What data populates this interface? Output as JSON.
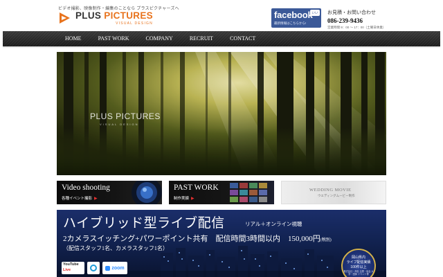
{
  "header": {
    "tagline": "ビデオ撮影、映像制作・編集のことなら プラスピクチャーズへ",
    "logo_name_a": "PLUS ",
    "logo_name_b": "PICTURES",
    "logo_sub": "VISUAL DESIGN"
  },
  "facebook": {
    "word": "facebook",
    "tag": "いいね!",
    "sub": "最新情報はこちらから!"
  },
  "contact": {
    "label": "お見積・お問い合わせ",
    "phone": "086-239-9436",
    "hours": "営業時間 9：00 ～ 17：00（土曜日休業）"
  },
  "nav": {
    "items": [
      "HOME",
      "PAST WORK",
      "COMPANY",
      "RECRUIT",
      "CONTACT"
    ]
  },
  "hero": {
    "title": "PLUS PICTURES",
    "subtitle": "VISUAL DESIGN"
  },
  "cards": [
    {
      "title": "Video shooting",
      "sub": "各種イベント撮影",
      "arrow": "▶"
    },
    {
      "title": "PAST WORK",
      "sub": "制作実績",
      "arrow": "▶"
    },
    {
      "title": "WEDDING MOVIE",
      "sub": "ウエディングムービー制作"
    }
  ],
  "live": {
    "title": "ハイブリッド型ライブ配信",
    "sub": "リアル＋オンライン視聴",
    "line2": "2カメラスイッチング+パワーポイント共有　配信時間3時間以内　150,000円",
    "tax": "(税別)",
    "line3": "（配信スタッフ1名、カメラスタッフ1名）",
    "badge": {
      "l1": "岡山県内",
      "l2": "ライブ配信実績",
      "l3": "100件以上",
      "small": "株式会社・商社 企業・協会\n大学・団体 イベント等"
    },
    "logos": {
      "youtube_name": "YouTube",
      "youtube_live": "Live",
      "zoom": "zoom"
    }
  },
  "colors": {
    "accent": "#e8731d",
    "nav_bg": "#2a2a2a",
    "facebook": "#3b5998",
    "banner_blue": "#122352"
  }
}
